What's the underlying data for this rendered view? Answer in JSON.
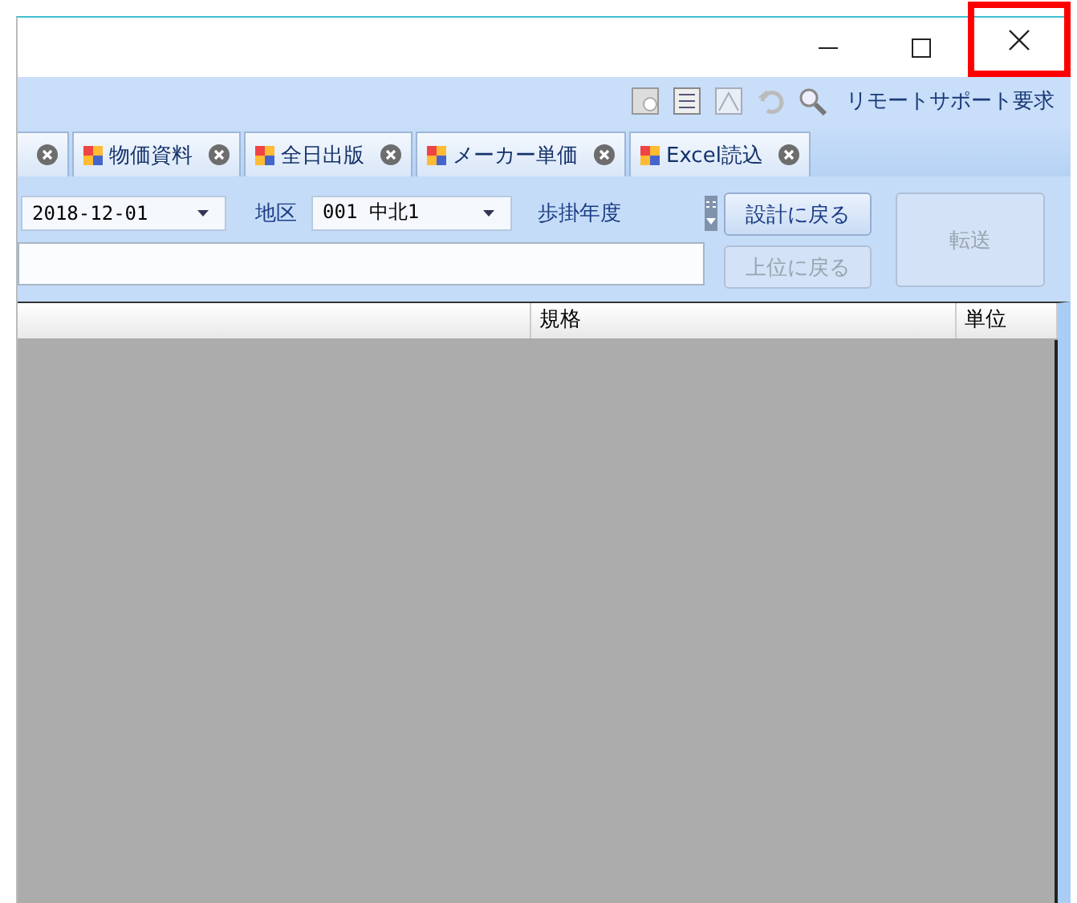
{
  "title_bar": {
    "close_highlighted": true
  },
  "toolbar": {
    "remote_support": "リモートサポート要求"
  },
  "tabs": [
    {
      "kind": "clipped"
    },
    {
      "kind": "full",
      "label": "物価資料"
    },
    {
      "kind": "full",
      "label": "全日出版"
    },
    {
      "kind": "full",
      "label": "メーカー単価"
    },
    {
      "kind": "full",
      "label": "Excel読込"
    }
  ],
  "form": {
    "date": "2018-12-01",
    "area_label": "地区",
    "area": "001 中北1",
    "year_label": "歩掛年度",
    "buttons": [
      {
        "label": "設計に戻る",
        "disabled": false
      },
      {
        "label": "上位に戻る",
        "disabled": true
      }
    ],
    "transfer": {
      "label": "転送",
      "disabled": true
    }
  },
  "table": {
    "columns": [
      "",
      "規格",
      "単位"
    ]
  }
}
